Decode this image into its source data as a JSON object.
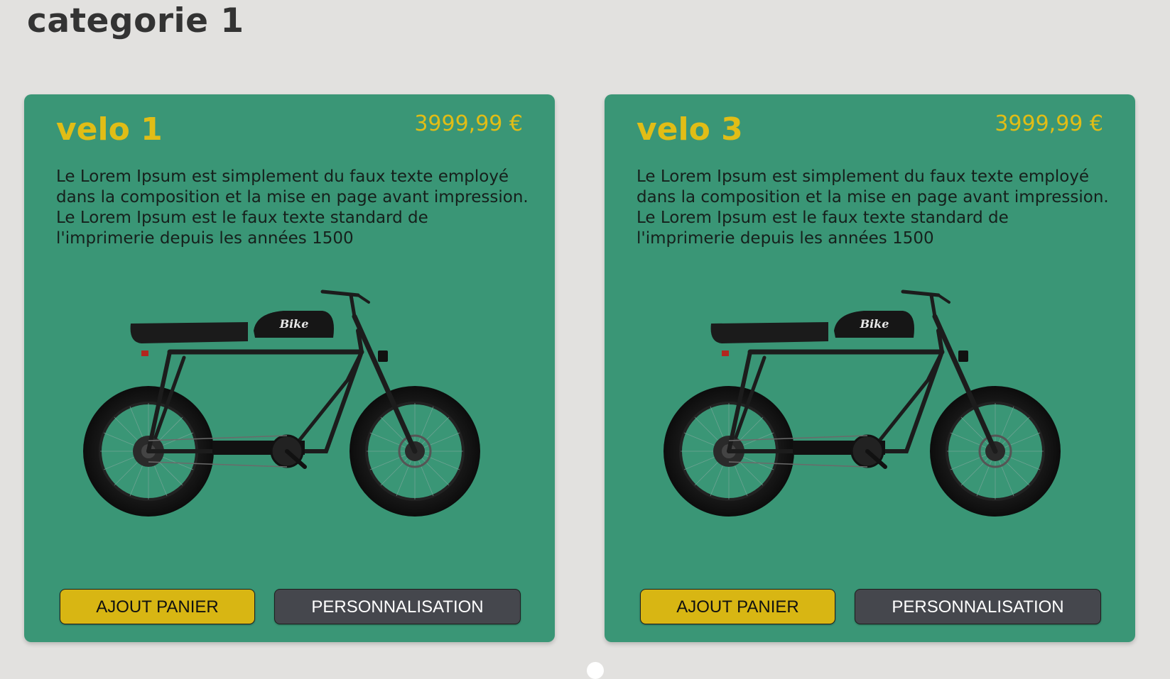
{
  "category": {
    "title": "categorie 1"
  },
  "products": [
    {
      "name": "velo 1",
      "price": "3999,99 €",
      "description": "Le Lorem Ipsum est simplement du faux texte employé dans la composition et la mise en page avant impression. Le Lorem Ipsum est le faux texte standard de l'imprimerie depuis les années 1500",
      "bike_logo_text": "Bike",
      "add_to_cart_label": "AJOUT PANIER",
      "customize_label": "PERSONNALISATION"
    },
    {
      "name": "velo 3",
      "price": "3999,99 €",
      "description": "Le Lorem Ipsum est simplement du faux texte employé dans la composition et la mise en page avant impression. Le Lorem Ipsum est le faux texte standard de l'imprimerie depuis les années 1500",
      "bike_logo_text": "Bike",
      "add_to_cart_label": "AJOUT PANIER",
      "customize_label": "PERSONNALISATION"
    }
  ],
  "colors": {
    "page_background": "#e2e1df",
    "card_background": "#3a9676",
    "accent_yellow": "#e1bd16",
    "button_dark": "#45474d"
  }
}
